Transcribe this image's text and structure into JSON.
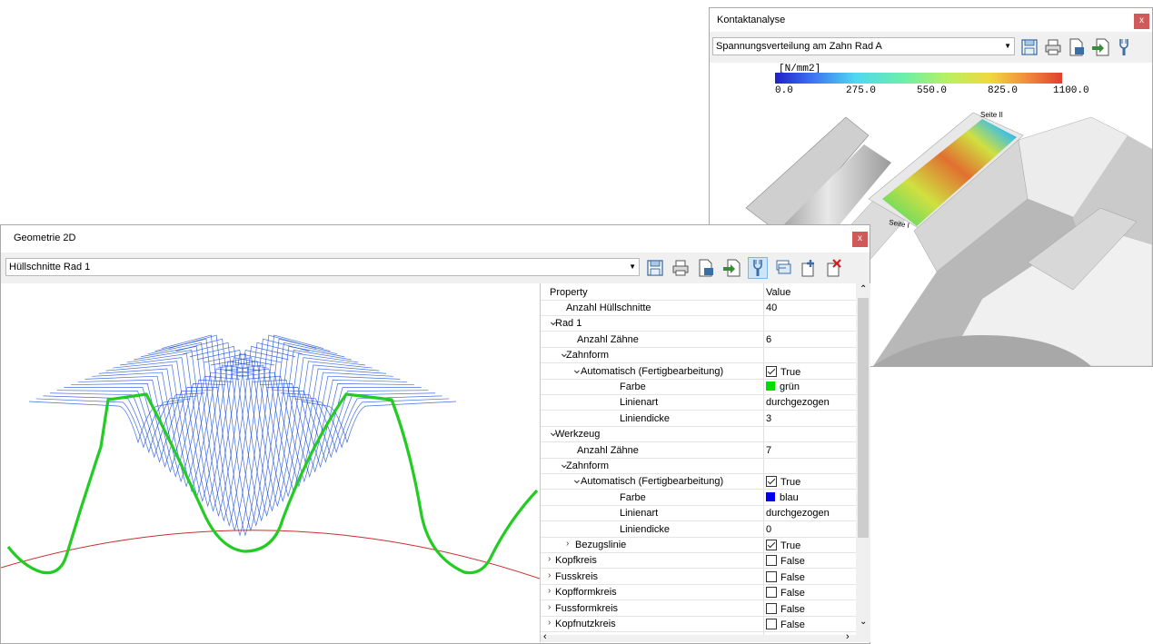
{
  "kontakt": {
    "title": "Kontaktanalyse",
    "close": "x",
    "view_select": "Spannungsverteilung am Zahn Rad A",
    "toolbar_icons": [
      "save-icon",
      "print-icon",
      "export-icon",
      "import-icon",
      "probe-icon"
    ],
    "legend": {
      "unit": "[N/mm2]",
      "ticks": [
        "0.0",
        "275.0",
        "550.0",
        "825.0",
        "1100.0"
      ]
    },
    "labels": {
      "side2": "Seite II",
      "side1": "Seite I"
    }
  },
  "geo": {
    "title": "Geometrie 2D",
    "close": "x",
    "view_select": "Hüllschnitte Rad 1",
    "toolbar_icons": [
      "save-icon",
      "print-icon",
      "export-icon",
      "import-icon",
      "probe-icon",
      "layers-icon",
      "add-icon",
      "delete-icon"
    ]
  },
  "colors": {
    "green": "#22cc22",
    "blue": "#2255dd",
    "red": "#c83030",
    "accent_blue": "#0000ee",
    "accent_green": "#00dd00"
  },
  "grid": {
    "header": {
      "property": "Property",
      "value": "Value"
    },
    "rows": [
      {
        "name": "Anzahl Hüllschnitte",
        "value": "40"
      },
      {
        "name": "Rad 1",
        "value": ""
      },
      {
        "name": "Anzahl Zähne",
        "value": "6"
      },
      {
        "name": "Zahnform",
        "value": ""
      },
      {
        "name": "Automatisch (Fertigbearbeitung)",
        "value": "True"
      },
      {
        "name": "Farbe",
        "value": "grün"
      },
      {
        "name": "Linienart",
        "value": "durchgezogen"
      },
      {
        "name": "Liniendicke",
        "value": "3"
      },
      {
        "name": "Werkzeug",
        "value": ""
      },
      {
        "name": "Anzahl Zähne",
        "value": "7"
      },
      {
        "name": "Zahnform",
        "value": ""
      },
      {
        "name": "Automatisch (Fertigbearbeitung)",
        "value": "True"
      },
      {
        "name": "Farbe",
        "value": "blau"
      },
      {
        "name": "Linienart",
        "value": "durchgezogen"
      },
      {
        "name": "Liniendicke",
        "value": "0"
      },
      {
        "name": "Bezugslinie",
        "value": "True"
      },
      {
        "name": "Kopfkreis",
        "value": "False"
      },
      {
        "name": "Fusskreis",
        "value": "False"
      },
      {
        "name": "Kopfformkreis",
        "value": "False"
      },
      {
        "name": "Fussformkreis",
        "value": "False"
      },
      {
        "name": "Kopfnutzkreis",
        "value": "False"
      }
    ]
  }
}
